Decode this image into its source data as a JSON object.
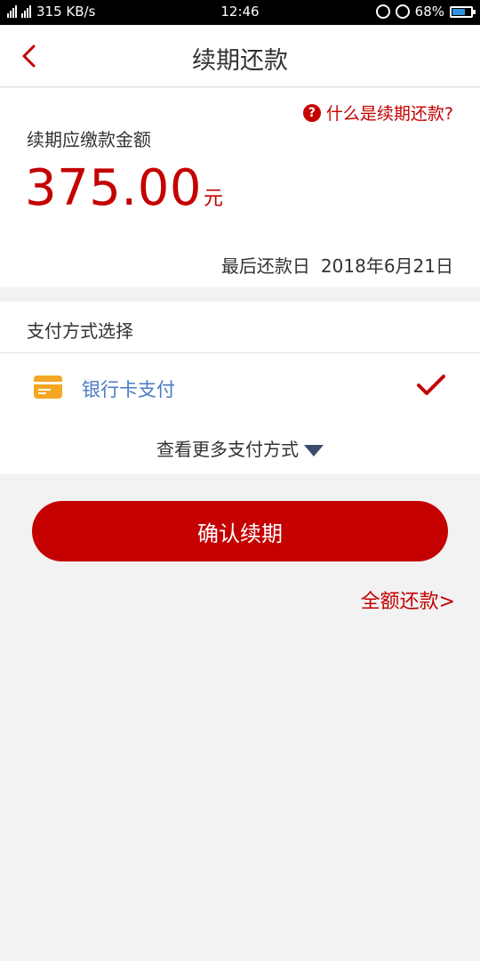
{
  "status_bar": {
    "network": "3G 4G",
    "speed": "315 KB/s",
    "time": "12:46",
    "battery": "68%",
    "battery_level": 0.68
  },
  "header": {
    "title": "续期还款",
    "back_icon": "chevron-left-icon"
  },
  "amount_card": {
    "help_link": "什么是续期还款?",
    "label": "续期应缴款金额",
    "amount": "375.00",
    "unit": "元",
    "due_label": "最后还款日",
    "due_date": "2018年6月21日"
  },
  "payment": {
    "heading": "支付方式选择",
    "option_label": "银行卡支付",
    "option_icon": "bank-card-icon",
    "selected": true,
    "more_label": "查看更多支付方式"
  },
  "actions": {
    "confirm_label": "确认续期",
    "full_repay_label": "全额还款>"
  },
  "colors": {
    "accent": "#c40000",
    "link_blue": "#4a7ac4",
    "card_orange": "#f5a623"
  }
}
